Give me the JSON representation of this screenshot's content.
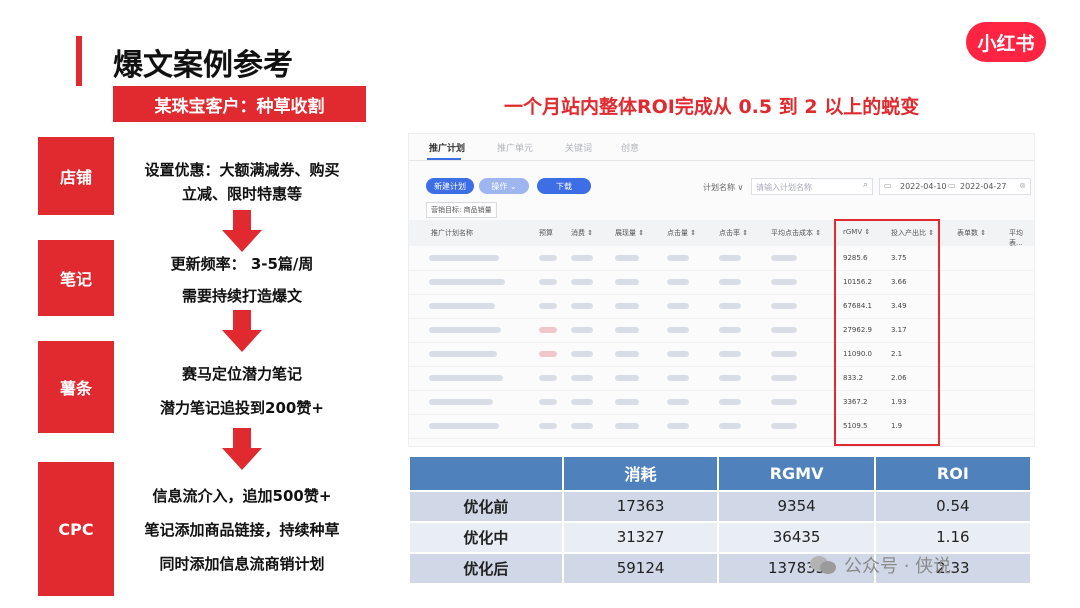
{
  "header": {
    "title": "爆文案例参考",
    "subtitle": "某珠宝客户：种草收割",
    "headline": "一个月站内整体ROI完成从 0.5 到 2 以上的蜕变",
    "logo_text": "小红书"
  },
  "stages": [
    {
      "label": "店铺",
      "lines": [
        "设置优惠：大额满减券、购买",
        "立减、限时特惠等"
      ]
    },
    {
      "label": "笔记",
      "lines": [
        "更新频率：   3-5篇/周",
        "需要持续打造爆文"
      ]
    },
    {
      "label": "薯条",
      "lines": [
        "赛马定位潜力笔记",
        "潜力笔记追投到200赞+"
      ]
    },
    {
      "label": "CPC",
      "lines": [
        "信息流介入，追加500赞+",
        "笔记添加商品链接，持续种草",
        "同时添加信息流商销计划"
      ]
    }
  ],
  "dashboard": {
    "tabs": [
      "推广计划",
      "推广单元",
      "关键词",
      "创意"
    ],
    "buttons": [
      "新建计划",
      "操作 ⌄",
      "下载"
    ],
    "filter_label": "计划名称 ∨",
    "search_placeholder": "请输入计划名称",
    "date_start": "2022-04-10",
    "date_end": "2022-04-27",
    "chip": "营销目标: 商品销量",
    "columns": [
      "推广计划名称",
      "预算",
      "消费 ⇕",
      "展现量 ⇕",
      "点击量 ⇕",
      "点击率 ⇕",
      "平均点击成本 ⇕",
      "rGMV ⇕",
      "投入产出比 ⇕",
      "表单数 ⇕",
      "平均表..."
    ],
    "rgmv": [
      "9285.6",
      "10156.2",
      "67684.1",
      "27962.9",
      "11090.0",
      "833.2",
      "3367.2",
      "5109.5"
    ],
    "roi": [
      "3.75",
      "3.66",
      "3.49",
      "3.17",
      "2.1",
      "2.06",
      "1.93",
      "1.9"
    ]
  },
  "comparison": {
    "headers": [
      "",
      "消耗",
      "RGMV",
      "ROI"
    ],
    "rows": [
      {
        "label": "优化前",
        "spend": "17363",
        "rgmv": "9354",
        "roi": "0.54"
      },
      {
        "label": "优化中",
        "spend": "31327",
        "rgmv": "36435",
        "roi": "1.16"
      },
      {
        "label": "优化后",
        "spend": "59124",
        "rgmv": "137833",
        "roi": "2.33"
      }
    ]
  },
  "watermark": "公众号 · 侠说",
  "colors": {
    "accent": "#e02a2f",
    "table_header": "#4f81bd",
    "brand": "#ff2442"
  }
}
